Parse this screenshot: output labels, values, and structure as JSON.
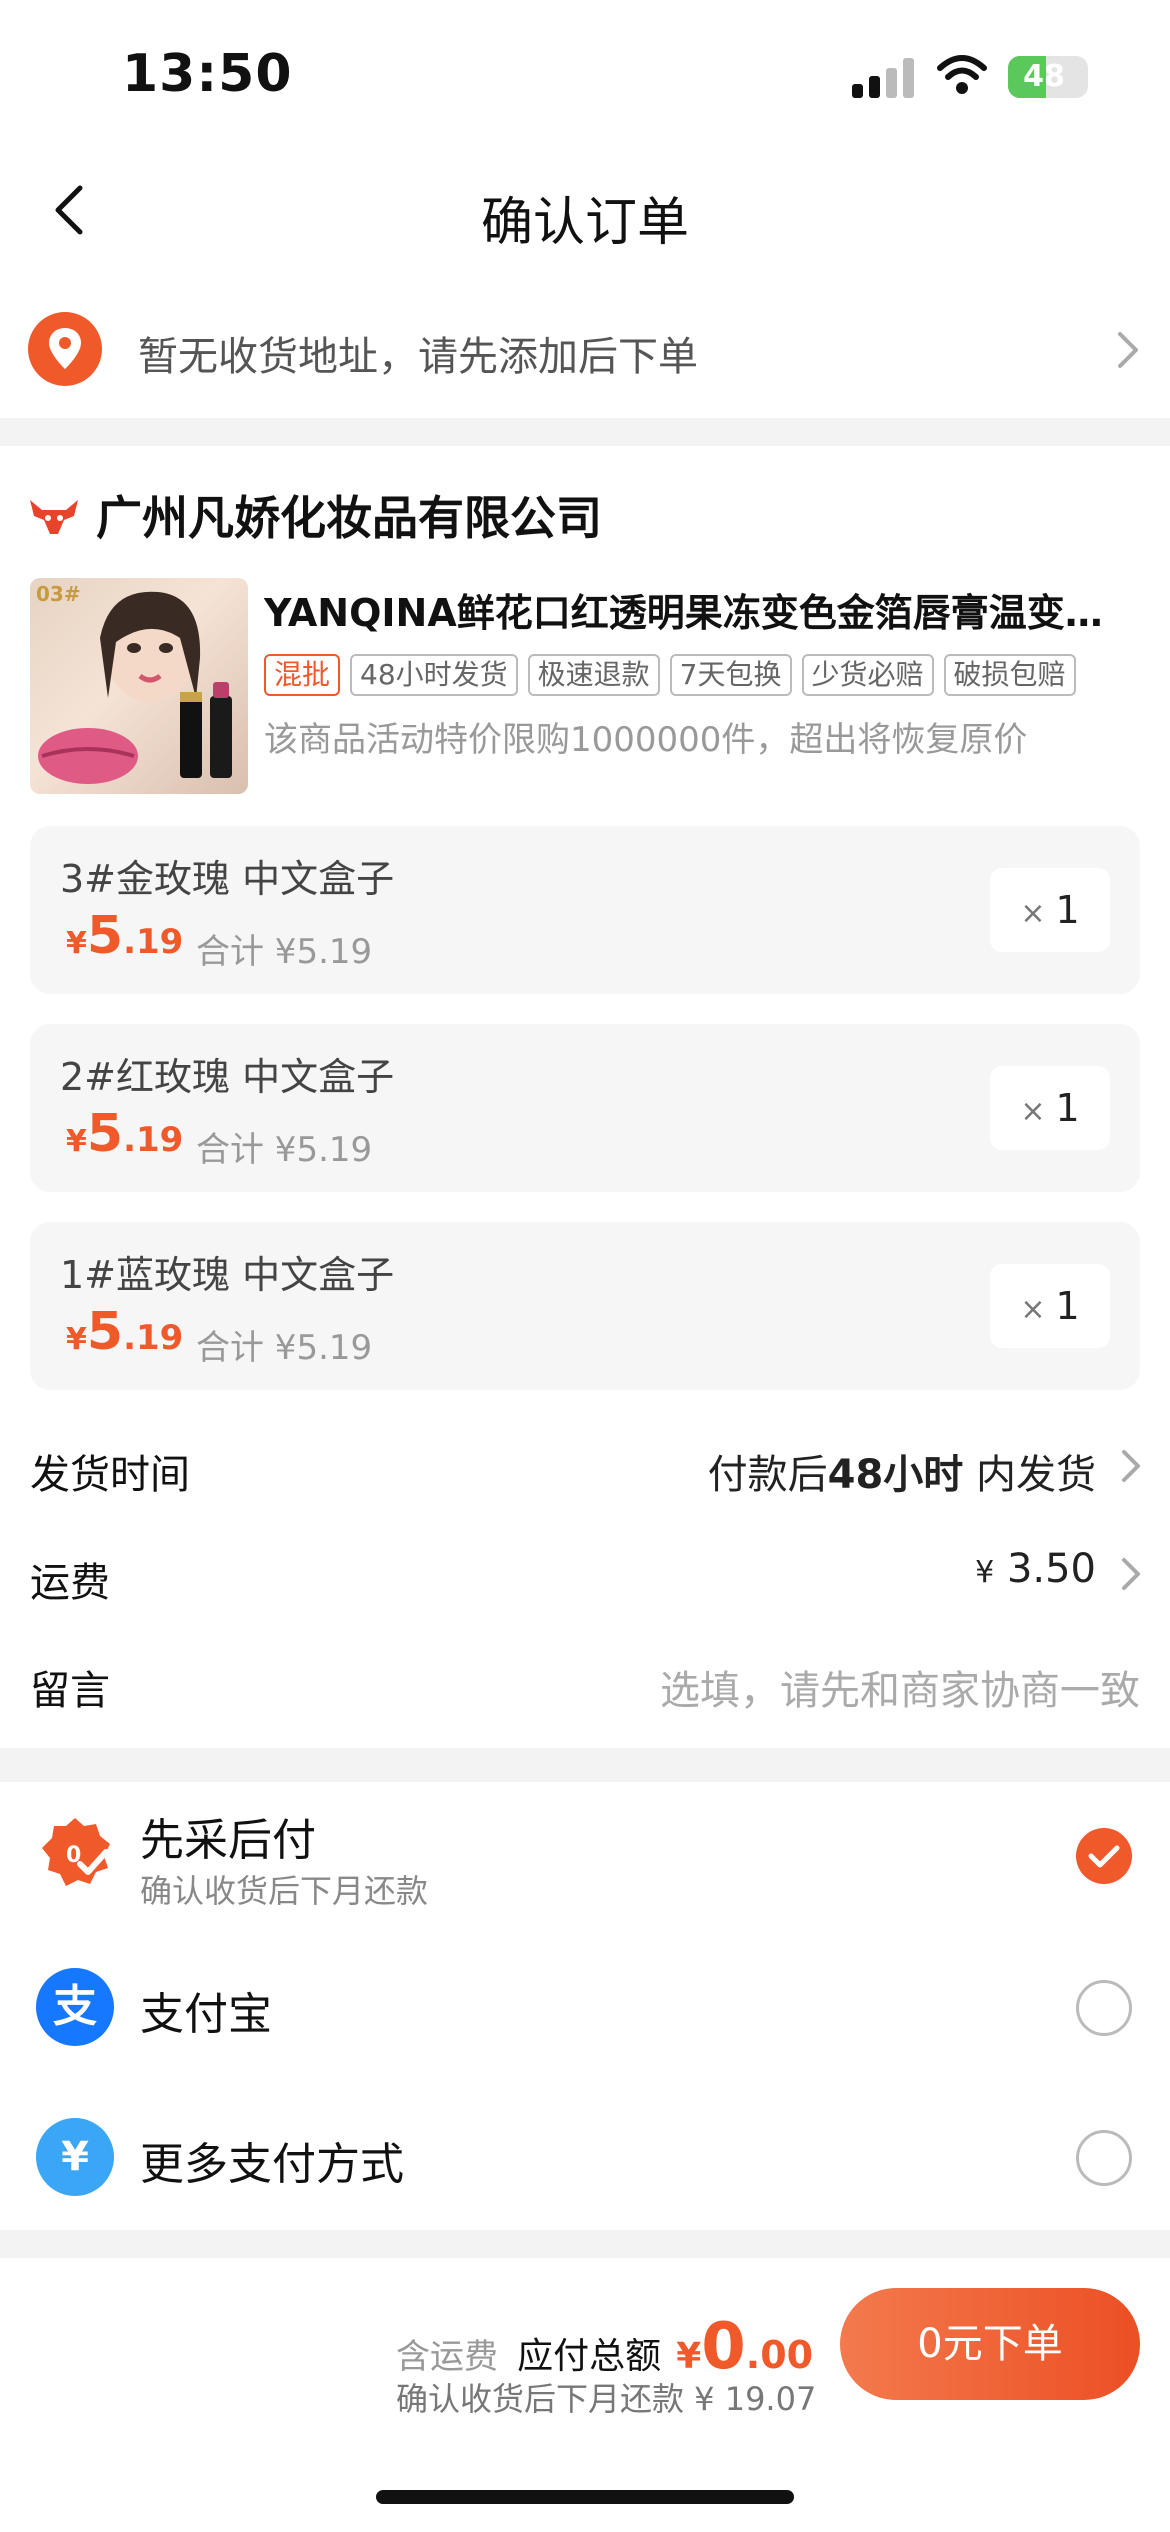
{
  "status_bar": {
    "time": "13:50",
    "battery": "48",
    "battery_level_percent": 48
  },
  "nav": {
    "title": "确认订单",
    "back_icon": "chevron-left-icon"
  },
  "address": {
    "placeholder_text": "暂无收货地址，请先添加后下单",
    "icon": "location-pin-icon"
  },
  "shop": {
    "name": "广州凡娇化妆品有限公司",
    "logo_icon": "bull-logo-icon",
    "product": {
      "title": "YANQINA鲜花口红透明果冻变色金箔唇膏温变…",
      "image_label": "03#",
      "tags": [
        "混批",
        "48小时发货",
        "极速退款",
        "7天包换",
        "少货必赔",
        "破损包赔"
      ],
      "promo_note": "该商品活动特价限购1000000件，超出将恢复原价"
    },
    "skus": [
      {
        "name": "3#金玫瑰 中文盒子",
        "yen": "¥",
        "price_int": "5",
        "price_dec": ".19",
        "total": "合计 ¥5.19",
        "qty_x": "×",
        "qty": "1"
      },
      {
        "name": "2#红玫瑰 中文盒子",
        "yen": "¥",
        "price_int": "5",
        "price_dec": ".19",
        "total": "合计 ¥5.19",
        "qty_x": "×",
        "qty": "1"
      },
      {
        "name": "1#蓝玫瑰 中文盒子",
        "yen": "¥",
        "price_int": "5",
        "price_dec": ".19",
        "total": "合计 ¥5.19",
        "qty_x": "×",
        "qty": "1"
      }
    ],
    "shipping_time": {
      "label": "发货时间",
      "prefix": "付款后",
      "bold": "48小时",
      "suffix": "内发货"
    },
    "shipping_fee": {
      "label": "运费",
      "yen": "¥",
      "value": "3.50"
    },
    "message": {
      "label": "留言",
      "placeholder": "选填，请先和商家协商一致"
    }
  },
  "payment": {
    "options": [
      {
        "title": "先采后付",
        "subtitle": "确认收货后下月还款",
        "selected": true,
        "icon": "buy-now-pay-later-icon",
        "color": "#f05a2b"
      },
      {
        "title": "支付宝",
        "selected": false,
        "icon": "alipay-icon",
        "glyph": "支",
        "color": "#1677ff"
      },
      {
        "title": "更多支付方式",
        "selected": false,
        "icon": "yen-circle-icon",
        "glyph": "¥",
        "color": "#3aa6f5"
      }
    ]
  },
  "footer": {
    "fee_label": "含运费",
    "total_label": "应付总额",
    "total_yen": "¥",
    "total_int": "0",
    "total_dec": ".00",
    "later_note": "确认收货后下月还款 ¥ 19.07",
    "order_button": "0元下单"
  },
  "colors": {
    "accent": "#f05a2b",
    "alipay": "#1677ff",
    "more_pay": "#3aa6f5"
  }
}
